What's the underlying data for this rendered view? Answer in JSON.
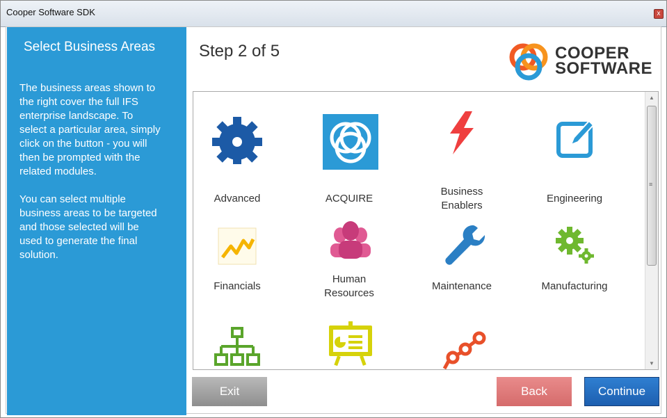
{
  "window": {
    "title": "Cooper Software SDK",
    "close_glyph": "x"
  },
  "sidebar": {
    "heading": "Select Business Areas",
    "para1": [
      "The business areas shown to",
      "the right cover the full IFS",
      "enterprise landscape. To",
      "select a particular area, simply",
      "click on the button - you will",
      "then be prompted with the",
      "related modules."
    ],
    "para2": [
      "You can select multiple",
      "business areas to be targeted",
      "and those selected will be",
      "used to generate the final",
      "solution."
    ],
    "bg_color": "#2b9ad6"
  },
  "header": {
    "step": "Step 2 of 5"
  },
  "logo": {
    "line1": "COOPER",
    "line2": "SOFTWARE"
  },
  "areas": [
    {
      "label": [
        "Advanced"
      ],
      "icon": "gear-icon",
      "color": "#1c5aa6"
    },
    {
      "label": [
        "ACQUIRE"
      ],
      "icon": "acquire-logo-icon",
      "color": "#2b9ad6"
    },
    {
      "label": [
        "Business",
        "Enablers"
      ],
      "icon": "lightning-icon",
      "color": "#ef3f3f"
    },
    {
      "label": [
        "Engineering"
      ],
      "icon": "edit-icon",
      "color": "#2b9ad6"
    },
    {
      "label": [
        "Financials"
      ],
      "icon": "chart-line-icon",
      "color": "#f5b400"
    },
    {
      "label": [
        "Human",
        "Resources"
      ],
      "icon": "people-icon",
      "color": "#e05a93"
    },
    {
      "label": [
        "Maintenance"
      ],
      "icon": "wrench-icon",
      "color": "#2b7fc4"
    },
    {
      "label": [
        "Manufacturing"
      ],
      "icon": "gears-icon",
      "color": "#6fb82f"
    },
    {
      "label": [
        ""
      ],
      "icon": "org-chart-icon",
      "color": "#5aa52b"
    },
    {
      "label": [
        ""
      ],
      "icon": "presentation-icon",
      "color": "#d6d20a"
    },
    {
      "label": [
        ""
      ],
      "icon": "workflow-icon",
      "color": "#e8502a"
    }
  ],
  "buttons": {
    "exit": "Exit",
    "back": "Back",
    "continue": "Continue"
  }
}
